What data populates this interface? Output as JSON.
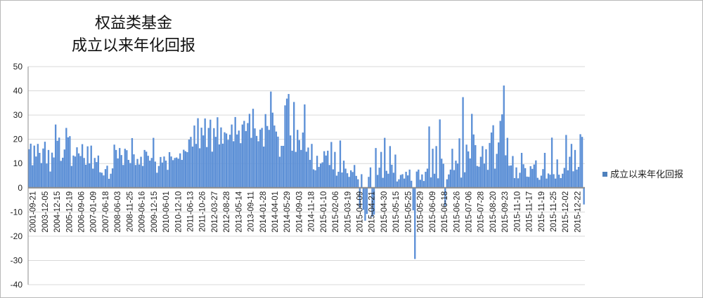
{
  "chart_data": {
    "type": "bar",
    "title_lines": [
      "权益类基金",
      "成立以来年化回报"
    ],
    "ylim": [
      -40,
      50
    ],
    "yticks": [
      -40,
      -30,
      -20,
      -10,
      0,
      10,
      20,
      30,
      40,
      50
    ],
    "grid": true,
    "legend_position": "right",
    "colors": {
      "bar": "#5b8fd6",
      "grid": "#d9d9d9",
      "axis": "#8c8c8c",
      "legend_swatch": "#4f81bd"
    },
    "series": [
      {
        "name": "成立以来年化回报",
        "values": [
          15.9,
          18.2,
          9.3,
          17.4,
          12.9,
          18.1,
          14.4,
          10.2,
          16.2,
          19.0,
          10.0,
          15.6,
          6.7,
          14.5,
          12.5,
          26.1,
          19.4,
          20.7,
          11.1,
          12.4,
          15.8,
          24.7,
          20.8,
          21.3,
          9.0,
          13.3,
          12.9,
          16.7,
          14.2,
          13.1,
          18.0,
          12.3,
          9.5,
          17.1,
          10.1,
          17.4,
          7.9,
          12.3,
          10.6,
          13.3,
          6.4,
          6.2,
          5.1,
          7.7,
          9.1,
          3.7,
          5.8,
          8.0,
          17.8,
          15.6,
          12.1,
          16.4,
          13.5,
          9.4,
          16.1,
          15.5,
          11.5,
          10.2,
          20.5,
          13.8,
          9.4,
          11.9,
          9.6,
          12.8,
          9.0,
          15.6,
          14.9,
          13.2,
          11.2,
          12.3,
          20.6,
          10.8,
          6.2,
          9.0,
          12.7,
          10.4,
          12.9,
          11.2,
          7.4,
          14.7,
          12.9,
          11.4,
          12.3,
          12.5,
          12.0,
          14.2,
          11.5,
          15.7,
          15.1,
          14.7,
          19.9,
          21.0,
          17.0,
          25.7,
          18.1,
          28.7,
          16.3,
          24.8,
          21.6,
          28.6,
          16.8,
          24.7,
          28.1,
          14.9,
          24.6,
          21.0,
          29.1,
          17.9,
          24.9,
          18.2,
          22.9,
          22.4,
          19.8,
          21.9,
          26.1,
          19.2,
          29.2,
          22.0,
          23.6,
          18.4,
          26.1,
          27.6,
          23.4,
          26.7,
          30.5,
          20.6,
          32.6,
          24.5,
          21.4,
          19.2,
          24.0,
          24.7,
          17.0,
          30.4,
          25.5,
          23.9,
          39.7,
          31.0,
          25.7,
          23.2,
          21.1,
          12.8,
          17.3,
          17.3,
          34.0,
          36.8,
          38.7,
          21.6,
          15.3,
          35.4,
          14.8,
          23.9,
          19.7,
          15.6,
          22.8,
          34.4,
          14.9,
          16.6,
          11.5,
          18.1,
          7.6,
          7.2,
          13.2,
          8.6,
          10.0,
          10.5,
          15.1,
          13.3,
          15.3,
          9.4,
          18.9,
          7.6,
          14.8,
          5.0,
          6.6,
          19.5,
          6.3,
          11.2,
          7.9,
          6.0,
          4.5,
          7.2,
          6.5,
          9.4,
          4.9,
          3.5,
          -8.2,
          5.6,
          -9.1,
          -13.6,
          -10.8,
          4.5,
          8.4,
          -12.0,
          -11.1,
          16.4,
          5.3,
          8.3,
          14.8,
          4.1,
          20.6,
          7.0,
          5.8,
          17.2,
          9.5,
          6.2,
          13.7,
          2.6,
          3.5,
          5.3,
          5.6,
          3.8,
          6.6,
          5.1,
          7.5,
          2.9,
          -9.3,
          -29.4,
          6.7,
          7.5,
          3.3,
          5.5,
          2.8,
          6.6,
          7.9,
          25.3,
          4.3,
          16.1,
          5.8,
          17.2,
          3.9,
          28.2,
          12.0,
          9.9,
          -7.5,
          3.5,
          5.5,
          7.5,
          16.1,
          7.3,
          11.2,
          10.0,
          20.4,
          4.2,
          37.4,
          6.4,
          17.8,
          15.0,
          12.1,
          30.5,
          22.0,
          17.6,
          9.0,
          8.7,
          12.8,
          17.2,
          10.0,
          15.9,
          7.4,
          18.5,
          22.8,
          25.8,
          7.9,
          14.0,
          18.7,
          27.6,
          30.3,
          42.2,
          13.4,
          20.6,
          9.1,
          9.2,
          13.1,
          4.0,
          8.4,
          3.9,
          6.2,
          14.4,
          9.7,
          8.1,
          4.6,
          4.5,
          8.9,
          7.8,
          9.6,
          11.3,
          4.1,
          3.3,
          5.0,
          7.7,
          14.4,
          3.8,
          5.9,
          5.4,
          20.7,
          5.6,
          3.8,
          11.7,
          5.4,
          4.0,
          5.8,
          8.2,
          21.8,
          7.2,
          12.8,
          18.1,
          6.8,
          15.6,
          7.5,
          8.6,
          22.1,
          21.0,
          -6.9
        ]
      }
    ],
    "xticks": [
      "2001-09-21",
      "2003-12-05",
      "2004-12-15",
      "2005-12-19",
      "2006-09-06",
      "2007-01-09",
      "2007-06-18",
      "2008-06-03",
      "2008-11-25",
      "2009-06-16",
      "2009-12-15",
      "2010-06-01",
      "2010-12-10",
      "2011-06-13",
      "2011-10-26",
      "2012-03-27",
      "2012-08-28",
      "2013-05-14",
      "2013-09-11",
      "2014-01-28",
      "2014-04-01",
      "2014-05-29",
      "2014-09-03",
      "2014-11-18",
      "2015-01-10",
      "2015-02-06",
      "2015-03-19",
      "2015-04-09",
      "2015-04-21",
      "2015-04-30",
      "2015-05-15",
      "2015-05-25",
      "2015-05-29",
      "2015-06-09",
      "2015-06-18",
      "2015-06-26",
      "2015-07-06",
      "2015-07-28",
      "2015-08-20",
      "2015-09-23",
      "2015-11-10",
      "2015-11-17",
      "2015-11-19",
      "2015-11-25",
      "2015-12-02",
      "2015-12-22"
    ]
  }
}
